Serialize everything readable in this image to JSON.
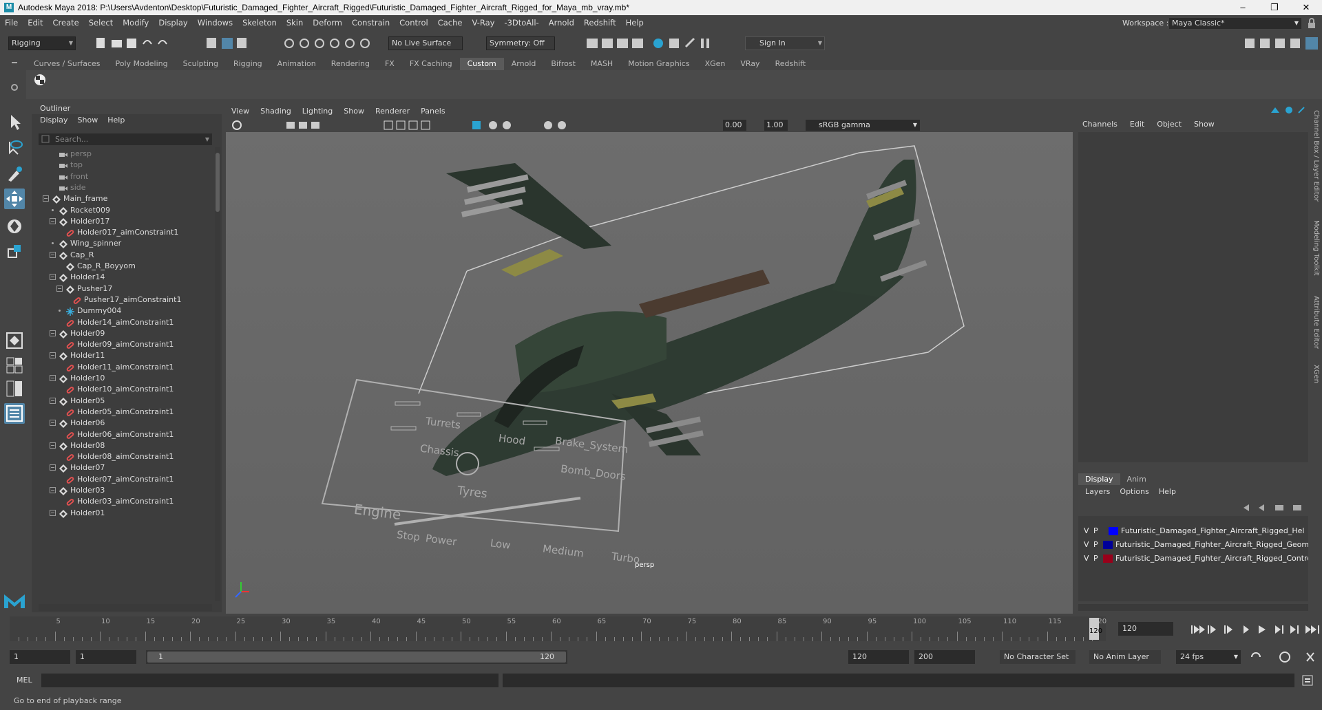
{
  "window": {
    "title": "Autodesk Maya 2018: P:\\Users\\Avdenton\\Desktop\\Futuristic_Damaged_Fighter_Aircraft_Rigged\\Futuristic_Damaged_Fighter_Aircraft_Rigged_for_Maya_mb_vray.mb*",
    "app_icon": "M"
  },
  "menubar": [
    "File",
    "Edit",
    "Create",
    "Select",
    "Modify",
    "Display",
    "Windows",
    "Skeleton",
    "Skin",
    "Deform",
    "Constrain",
    "Control",
    "Cache",
    "V-Ray",
    "-3DtoAll-",
    "Arnold",
    "Redshift",
    "Help"
  ],
  "workspace": {
    "label": "Workspace :",
    "value": "Maya Classic*"
  },
  "statusline": {
    "menuset": "Rigging",
    "live_surface": "No Live Surface",
    "symmetry": "Symmetry: Off",
    "sign_in": "Sign In"
  },
  "shelf": {
    "tabs": [
      "Curves / Surfaces",
      "Poly Modeling",
      "Sculpting",
      "Rigging",
      "Animation",
      "Rendering",
      "FX",
      "FX Caching",
      "Custom",
      "Arnold",
      "Bifrost",
      "MASH",
      "Motion Graphics",
      "XGen",
      "VRay",
      "Redshift"
    ],
    "active": "Custom"
  },
  "outliner": {
    "title": "Outliner",
    "menu": [
      "Display",
      "Show",
      "Help"
    ],
    "search_placeholder": "Search...",
    "nodes": [
      {
        "label": "persp",
        "depth": 1,
        "type": "camera",
        "dim": true,
        "exp": ""
      },
      {
        "label": "top",
        "depth": 1,
        "type": "camera",
        "dim": true,
        "exp": ""
      },
      {
        "label": "front",
        "depth": 1,
        "type": "camera",
        "dim": true,
        "exp": ""
      },
      {
        "label": "side",
        "depth": 1,
        "type": "camera",
        "dim": true,
        "exp": ""
      },
      {
        "label": "Main_frame",
        "depth": 0,
        "type": "transform",
        "dim": false,
        "exp": "-"
      },
      {
        "label": "Rocket009",
        "depth": 1,
        "type": "transform",
        "dim": false,
        "exp": "+"
      },
      {
        "label": "Holder017",
        "depth": 1,
        "type": "transform",
        "dim": false,
        "exp": "-"
      },
      {
        "label": "Holder017_aimConstraint1",
        "depth": 2,
        "type": "constraint",
        "dim": false,
        "exp": ""
      },
      {
        "label": "Wing_spinner",
        "depth": 1,
        "type": "transform",
        "dim": false,
        "exp": "+"
      },
      {
        "label": "Cap_R",
        "depth": 1,
        "type": "transform",
        "dim": false,
        "exp": "-"
      },
      {
        "label": "Cap_R_Boyyom",
        "depth": 2,
        "type": "transform",
        "dim": false,
        "exp": ""
      },
      {
        "label": "Holder14",
        "depth": 1,
        "type": "transform",
        "dim": false,
        "exp": "-"
      },
      {
        "label": "Pusher17",
        "depth": 2,
        "type": "transform",
        "dim": false,
        "exp": "-"
      },
      {
        "label": "Pusher17_aimConstraint1",
        "depth": 3,
        "type": "constraint",
        "dim": false,
        "exp": ""
      },
      {
        "label": "Dummy004",
        "depth": 2,
        "type": "locator",
        "dim": false,
        "exp": "+"
      },
      {
        "label": "Holder14_aimConstraint1",
        "depth": 2,
        "type": "constraint",
        "dim": false,
        "exp": ""
      },
      {
        "label": "Holder09",
        "depth": 1,
        "type": "transform",
        "dim": false,
        "exp": "-"
      },
      {
        "label": "Holder09_aimConstraint1",
        "depth": 2,
        "type": "constraint",
        "dim": false,
        "exp": ""
      },
      {
        "label": "Holder11",
        "depth": 1,
        "type": "transform",
        "dim": false,
        "exp": "-"
      },
      {
        "label": "Holder11_aimConstraint1",
        "depth": 2,
        "type": "constraint",
        "dim": false,
        "exp": ""
      },
      {
        "label": "Holder10",
        "depth": 1,
        "type": "transform",
        "dim": false,
        "exp": "-"
      },
      {
        "label": "Holder10_aimConstraint1",
        "depth": 2,
        "type": "constraint",
        "dim": false,
        "exp": ""
      },
      {
        "label": "Holder05",
        "depth": 1,
        "type": "transform",
        "dim": false,
        "exp": "-"
      },
      {
        "label": "Holder05_aimConstraint1",
        "depth": 2,
        "type": "constraint",
        "dim": false,
        "exp": ""
      },
      {
        "label": "Holder06",
        "depth": 1,
        "type": "transform",
        "dim": false,
        "exp": "-"
      },
      {
        "label": "Holder06_aimConstraint1",
        "depth": 2,
        "type": "constraint",
        "dim": false,
        "exp": ""
      },
      {
        "label": "Holder08",
        "depth": 1,
        "type": "transform",
        "dim": false,
        "exp": "-"
      },
      {
        "label": "Holder08_aimConstraint1",
        "depth": 2,
        "type": "constraint",
        "dim": false,
        "exp": ""
      },
      {
        "label": "Holder07",
        "depth": 1,
        "type": "transform",
        "dim": false,
        "exp": "-"
      },
      {
        "label": "Holder07_aimConstraint1",
        "depth": 2,
        "type": "constraint",
        "dim": false,
        "exp": ""
      },
      {
        "label": "Holder03",
        "depth": 1,
        "type": "transform",
        "dim": false,
        "exp": "-"
      },
      {
        "label": "Holder03_aimConstraint1",
        "depth": 2,
        "type": "constraint",
        "dim": false,
        "exp": ""
      },
      {
        "label": "Holder01",
        "depth": 1,
        "type": "transform",
        "dim": false,
        "exp": "-"
      }
    ]
  },
  "viewport": {
    "menu": [
      "View",
      "Shading",
      "Lighting",
      "Show",
      "Renderer",
      "Panels"
    ],
    "exposure": "0.00",
    "gamma": "1.00",
    "color_space": "sRGB gamma",
    "camera_label": "persp",
    "control_board": {
      "labels": [
        "Turrets",
        "Hood",
        "Brake_System",
        "Chassis",
        "Bomb_Doors",
        "Tyres",
        "Engine",
        "Stop",
        "Power",
        "Low",
        "Medium",
        "Turbo"
      ]
    }
  },
  "channel_box": {
    "menu": [
      "Channels",
      "Edit",
      "Object",
      "Show"
    ],
    "side_tabs": [
      "Channel Box / Layer Editor",
      "Modeling Toolkit",
      "Attribute Editor",
      "XGen"
    ]
  },
  "layer_editor": {
    "tabs": [
      "Display",
      "Anim"
    ],
    "active_tab": "Display",
    "menu": [
      "Layers",
      "Options",
      "Help"
    ],
    "layers": [
      {
        "v": "V",
        "p": "P",
        "color": "#0000ff",
        "name": "Futuristic_Damaged_Fighter_Aircraft_Rigged_Hel"
      },
      {
        "v": "V",
        "p": "P",
        "color": "#000099",
        "name": "Futuristic_Damaged_Fighter_Aircraft_Rigged_Geom"
      },
      {
        "v": "V",
        "p": "P",
        "color": "#99001a",
        "name": "Futuristic_Damaged_Fighter_Aircraft_Rigged_Contro"
      }
    ]
  },
  "timeslider": {
    "ticks": [
      "5",
      "10",
      "15",
      "20",
      "25",
      "30",
      "35",
      "40",
      "45",
      "50",
      "55",
      "60",
      "65",
      "70",
      "75",
      "80",
      "85",
      "90",
      "95",
      "100",
      "105",
      "110",
      "115",
      "120"
    ],
    "current_frame": "120",
    "current_field": "120"
  },
  "range": {
    "start": "1",
    "playback_start": "1",
    "range_start_label": "1",
    "range_end_label": "120",
    "playback_end": "120",
    "end": "200",
    "character_set": "No Character Set",
    "anim_layer": "No Anim Layer",
    "fps": "24 fps"
  },
  "cmdline": {
    "label": "MEL"
  },
  "helpline": {
    "text": "Go to end of playback range"
  }
}
